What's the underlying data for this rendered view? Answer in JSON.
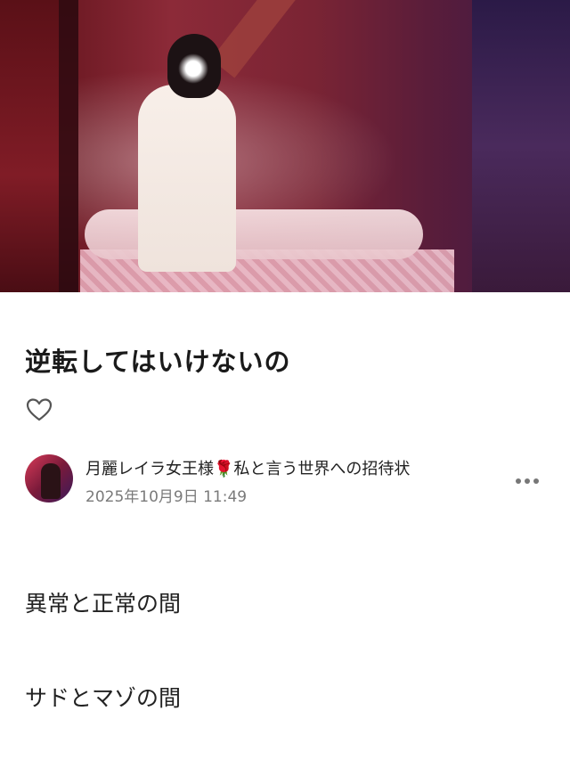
{
  "hero_image": {
    "alt": "",
    "colors": {
      "primary": "#8c2a38",
      "accent": "#3a1a4a"
    }
  },
  "article": {
    "title": "逆転してはいけないの",
    "like_icon": "heart-outline-icon",
    "author": {
      "name": "月麗レイラ女王様",
      "emoji": "🌹",
      "tagline": "私と言う世界への招待状",
      "date": "2025年10月9日 11:49"
    },
    "more_icon": "more-horizontal-icon",
    "paragraphs": [
      "異常と正常の間",
      "サドとマゾの間"
    ]
  }
}
